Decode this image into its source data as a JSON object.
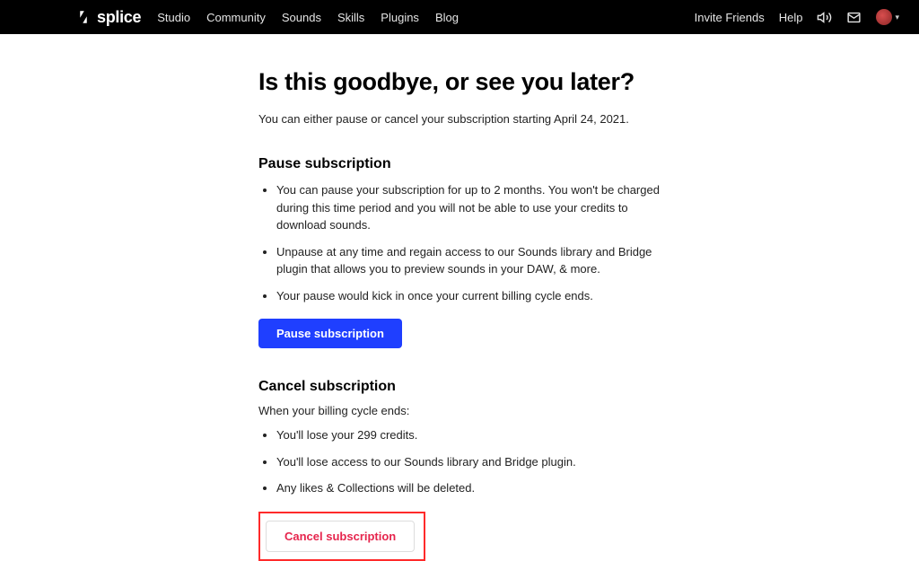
{
  "header": {
    "brand": "splice",
    "nav": [
      "Studio",
      "Community",
      "Sounds",
      "Skills",
      "Plugins",
      "Blog"
    ],
    "invite": "Invite Friends",
    "help": "Help"
  },
  "page": {
    "title": "Is this goodbye, or see you later?",
    "intro": "You can either pause or cancel your subscription starting April 24, 2021."
  },
  "pause": {
    "heading": "Pause subscription",
    "bullets": [
      "You can pause your subscription for up to 2 months. You won't be charged during this time period and you will not be able to use your credits to download sounds.",
      "Unpause at any time and regain access to our Sounds library and Bridge plugin that allows you to preview sounds in your DAW, & more.",
      "Your pause would kick in once your current billing cycle ends."
    ],
    "button": "Pause subscription"
  },
  "cancel": {
    "heading": "Cancel subscription",
    "lead": "When your billing cycle ends:",
    "bullets": [
      "You'll lose your 299 credits.",
      "You'll lose access to our Sounds library and Bridge plugin.",
      "Any likes & Collections will be deleted."
    ],
    "button": "Cancel subscription"
  }
}
